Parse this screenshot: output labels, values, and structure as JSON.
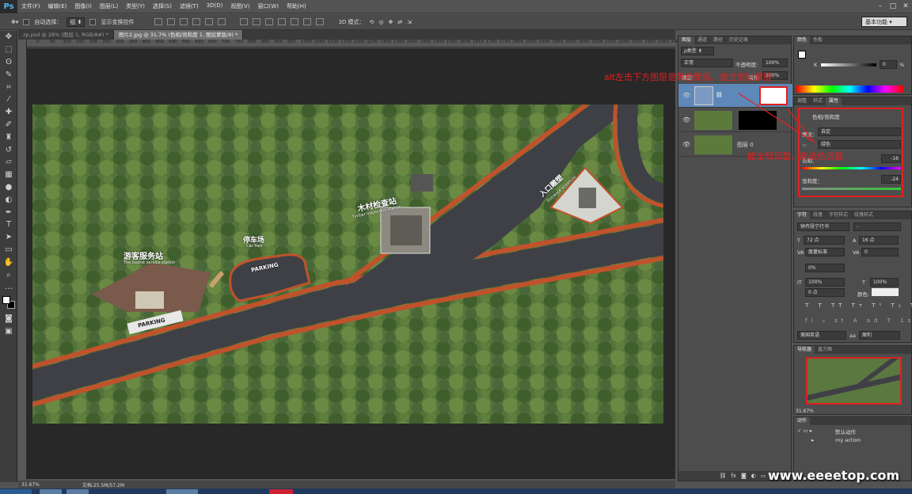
{
  "app": {
    "logo": "Ps"
  },
  "menu": [
    "文件(F)",
    "编辑(E)",
    "图像(I)",
    "图层(L)",
    "类型(Y)",
    "选择(S)",
    "滤镜(T)",
    "3D(D)",
    "视图(V)",
    "窗口(W)",
    "帮助(H)"
  ],
  "window_controls": [
    "–",
    "□",
    "✕"
  ],
  "options": {
    "auto_select_label": "自动选择：",
    "auto_select_value": "组",
    "show_transform_label": "显示变换控件",
    "mode_3d_label": "3D 模式："
  },
  "workspace": "基本功能",
  "doc_tabs": [
    {
      "label": "zp.psd @ 28% (图层 1, RGB/8#) *"
    },
    {
      "label": "图片2.jpg @ 31.7% (色相/饱和度 1, 图层蒙版/8) *"
    }
  ],
  "ruler_ticks": [
    "0",
    "50",
    "100",
    "150",
    "200",
    "250",
    "300",
    "350",
    "400",
    "450",
    "500",
    "550",
    "600",
    "650",
    "700",
    "750",
    "800",
    "850",
    "900",
    "950",
    "1000",
    "1050",
    "1100",
    "1150",
    "1200",
    "1250",
    "1300",
    "1350",
    "1400",
    "1450",
    "1500",
    "1550",
    "1600",
    "1650",
    "1700",
    "1750",
    "1800",
    "1850",
    "1900",
    "1950",
    "2000",
    "2050",
    "2100",
    "2150",
    "2200",
    "2250",
    "2300",
    "2350",
    "2400",
    "2450"
  ],
  "status": {
    "zoom": "31.67%",
    "doc": "文档:25.5M/57.2M"
  },
  "map": {
    "tourist_station_cn": "游客服务站",
    "tourist_station_en": "The tourist service station",
    "car_park_cn": "停车场",
    "car_park_en": "Car Park",
    "parking": "PARKING",
    "timber_cn": "木材检查站",
    "timber_en": "Timber inspection station",
    "entrance_cn": "入口雕塑",
    "entrance_en": "Entrance sculpture"
  },
  "layers_panel": {
    "tabs": [
      "图层",
      "通道",
      "路径",
      "历史记录"
    ],
    "kind_label": "ρ类型",
    "blend_mode": "正常",
    "opacity_label": "不透明度:",
    "opacity_value": "100%",
    "lock_label": "锁定:",
    "fill_label": "填充:",
    "fill_value": "100%",
    "layers": [
      {
        "name": ""
      },
      {
        "name": ""
      },
      {
        "name": "图层 0"
      }
    ]
  },
  "annotations": {
    "alt_note": "alt左击下方图层是黑色蒙版，建立剪贴蒙版",
    "global_note": "能全局调整，能选色调整"
  },
  "color_panel": {
    "tabs": [
      "颜色",
      "色板"
    ],
    "channel": "K",
    "value": "0",
    "unit": "%"
  },
  "properties_panel": {
    "tabs": [
      "调整",
      "样式",
      "属性"
    ],
    "title": "色相/饱和度",
    "preset_label": "预设：",
    "preset_value": "自定",
    "channel_value": "绿色",
    "hue_label": "色相：",
    "hue_value": "-16",
    "sat_label": "饱和度：",
    "sat_value": "-24"
  },
  "char_panel": {
    "tabs": [
      "字符",
      "段落",
      "字符样式",
      "段落样式"
    ],
    "font": "钟齐段宁行书",
    "font_style": "-",
    "size": "72 点",
    "leading": "16 点",
    "kerning": "度量标准",
    "tracking": "0",
    "vscale_pct": "0%",
    "scale_v": "100%",
    "scale_h": "100%",
    "baseline": "0 点",
    "color_label": "颜色:",
    "lang": "美国英语",
    "aa_label": "aa",
    "aa_value": "犀利"
  },
  "navigator": {
    "tabs": [
      "导航器",
      "直方图"
    ],
    "zoom": "31.67%"
  },
  "actions_panel": {
    "tabs": [
      "动作"
    ],
    "items": [
      "默认动作",
      "my action"
    ]
  },
  "watermark": "www.eeeetop.com",
  "colors": {
    "accent": "#e02020",
    "panel_bg": "#4d4d4d",
    "road": "#3f4046",
    "bike_lane": "#c0522c"
  }
}
